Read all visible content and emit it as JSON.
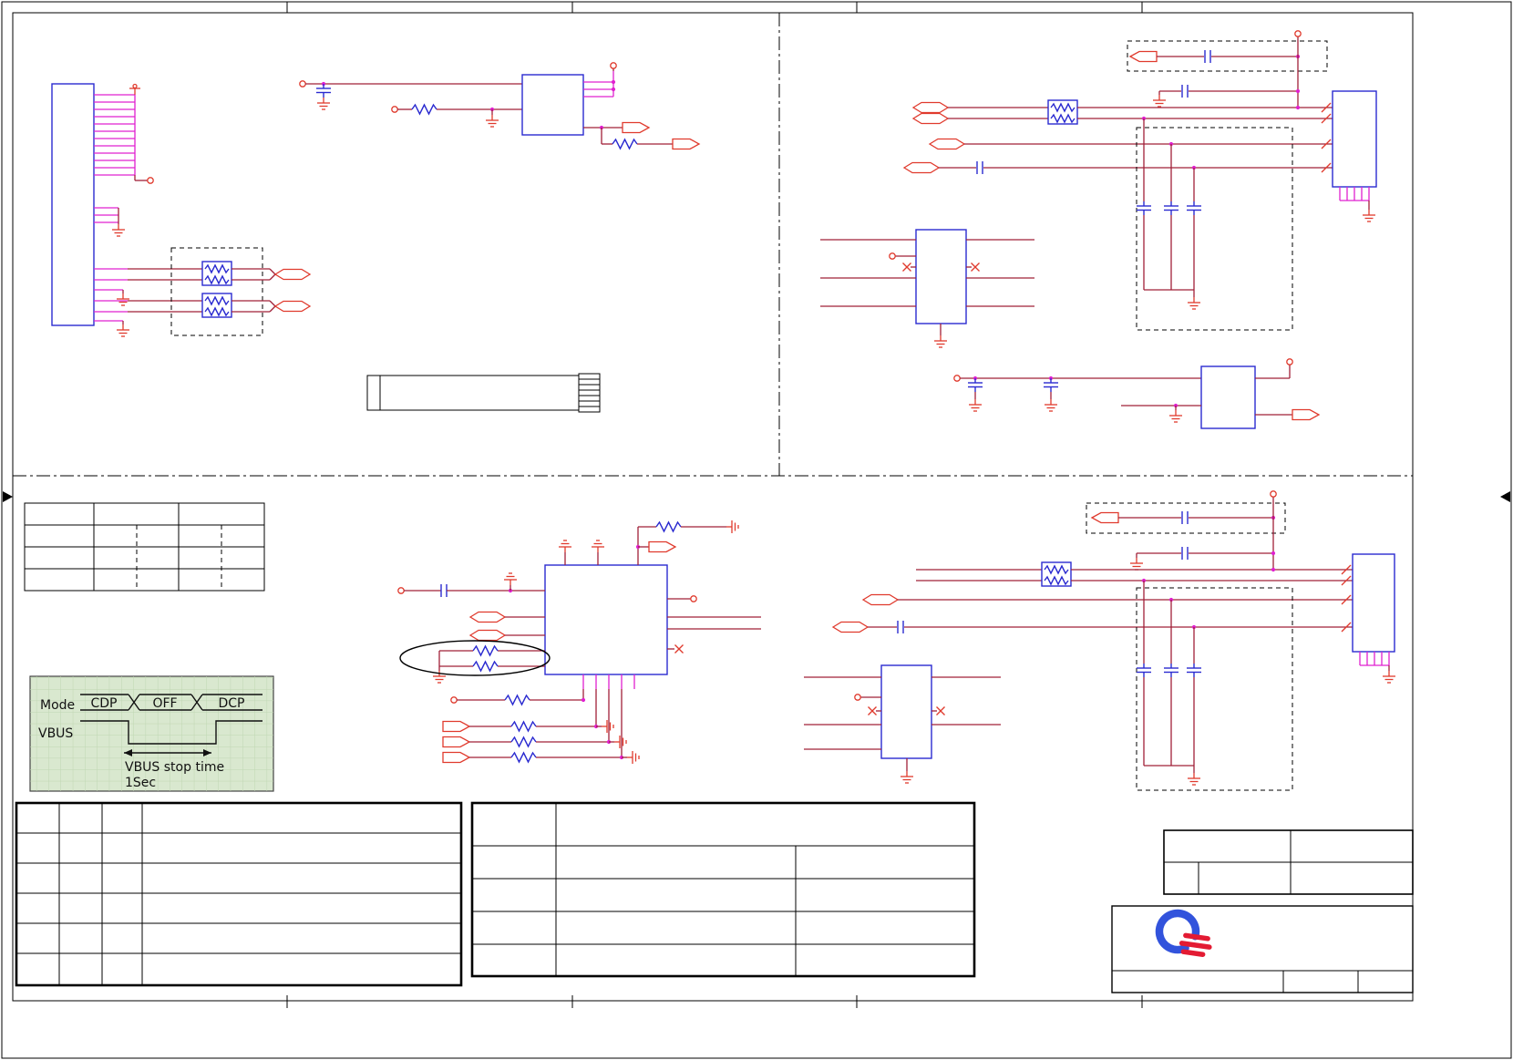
{
  "sheet": {
    "background": "#ffffff"
  },
  "palette": {
    "wire": "#a02038",
    "pin": "#e020d0",
    "component": "#2b2bd0",
    "symbol": "#e03a2d",
    "black": "#000000",
    "timing_bg": "#d9e8cf",
    "timing_grid": "#bfd6b2",
    "logo_blue": "#3253dc",
    "logo_red": "#e31b33"
  },
  "timing_diagram": {
    "mode_label": "Mode",
    "states": [
      "CDP",
      "OFF",
      "DCP"
    ],
    "vbus_label": "VBUS",
    "note_line1": "VBUS stop time",
    "note_line2": "1Sec"
  }
}
